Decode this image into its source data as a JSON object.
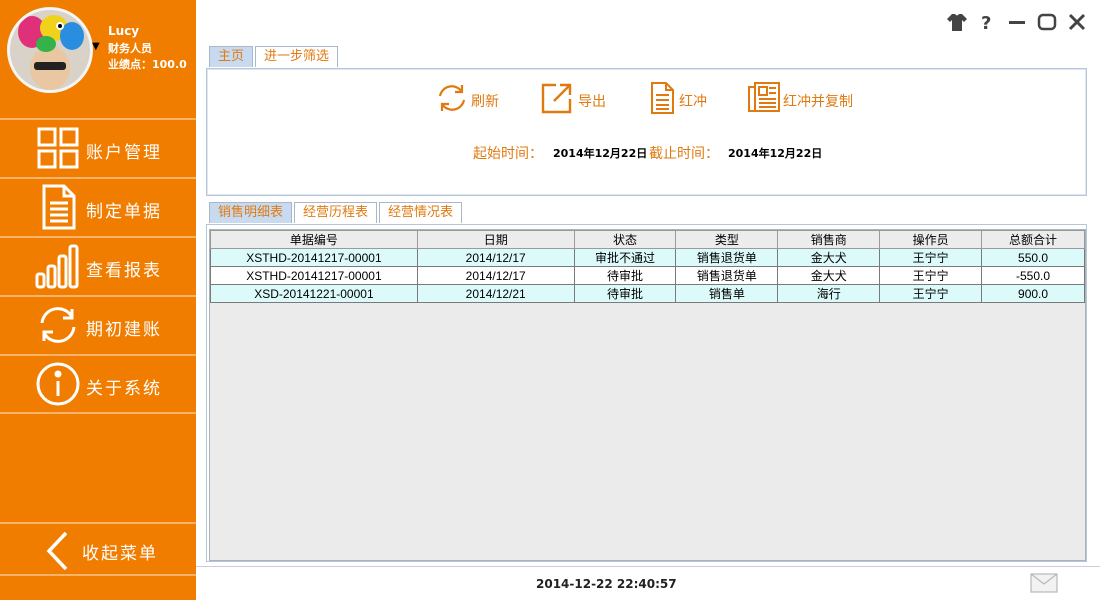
{
  "user": {
    "name": "Lucy",
    "role": "财务人员",
    "performance": "业绩点：100.0"
  },
  "sidebar": {
    "items": [
      {
        "label": "账户管理",
        "icon": "grid-icon"
      },
      {
        "label": "制定单据",
        "icon": "document-icon"
      },
      {
        "label": "查看报表",
        "icon": "bar-chart-icon"
      },
      {
        "label": "期初建账",
        "icon": "refresh-icon"
      },
      {
        "label": "关于系统",
        "icon": "info-icon"
      }
    ],
    "collapse_label": "收起菜单"
  },
  "window_controls": [
    "skin-icon",
    "help-icon",
    "minimize-icon",
    "maximize-icon",
    "close-icon"
  ],
  "top_tabs": [
    {
      "label": "主页",
      "active": true
    },
    {
      "label": "进一步筛选",
      "active": false
    }
  ],
  "toolbar": {
    "refresh": "刷新",
    "export": "导出",
    "red_offset": "红冲",
    "red_offset_copy": "红冲并复制"
  },
  "dates": {
    "start_label": "起始时间：",
    "start_value": "2014年12月22日",
    "end_label": "截止时间：",
    "end_value": "2014年12月22日"
  },
  "bottom_tabs": [
    {
      "label": "销售明细表",
      "active": true
    },
    {
      "label": "经营历程表",
      "active": false
    },
    {
      "label": "经营情况表",
      "active": false
    }
  ],
  "table": {
    "headers": [
      "单据编号",
      "日期",
      "状态",
      "类型",
      "销售商",
      "操作员",
      "总额合计"
    ],
    "rows": [
      [
        "XSTHD-20141217-00001",
        "2014/12/17",
        "审批不通过",
        "销售退货单",
        "金大犬",
        "王宁宁",
        "550.0"
      ],
      [
        "XSTHD-20141217-00001",
        "2014/12/17",
        "待审批",
        "销售退货单",
        "金大犬",
        "王宁宁",
        "-550.0"
      ],
      [
        "XSD-20141221-00001",
        "2014/12/21",
        "待审批",
        "销售单",
        "海行",
        "王宁宁",
        "900.0"
      ]
    ]
  },
  "status": {
    "datetime": "2014-12-22 22:40:57"
  },
  "colors": {
    "accent": "#f07d00",
    "label_orange": "#e07a10",
    "row_tint": "#dcfafa",
    "tab_active": "#c8daf0"
  }
}
